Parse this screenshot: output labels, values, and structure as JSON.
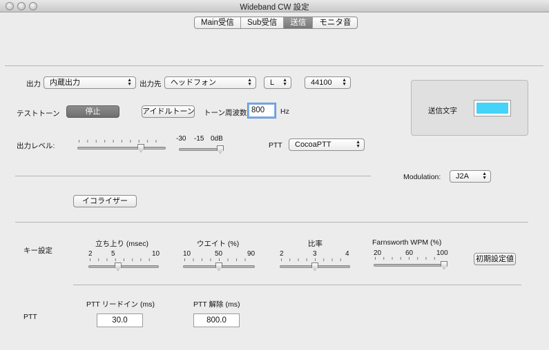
{
  "window": {
    "title": "Wideband CW 設定"
  },
  "tabs": [
    "Main受信",
    "Sub受信",
    "送信",
    "モニタ音"
  ],
  "active_tab_index": 2,
  "output": {
    "label": "出力",
    "device": "内蔵出力",
    "dest_label": "出力先",
    "dest": "ヘッドフォン",
    "channel": "L",
    "rate": "44100"
  },
  "test_tone": {
    "label": "テストトーン",
    "stop_button": "停止",
    "idle_button": "アイドルトーン",
    "freq_label": "トーン周波数",
    "freq_value": "800",
    "freq_unit": "Hz"
  },
  "send_text": {
    "label": "送信文字",
    "color": "#45d3fa"
  },
  "level": {
    "label": "出力レベル:",
    "slider1_value": 0.72,
    "slider2_ticks": [
      "-30",
      "-15",
      "0dB"
    ],
    "slider2_value": 1.0
  },
  "ptt_output": {
    "label": "PTT",
    "value": "CocoaPTT"
  },
  "modulation": {
    "label": "Modulation:",
    "value": "J2A"
  },
  "equalizer_button": "イコライザー",
  "key": {
    "section_label": "キー設定",
    "rise": {
      "label": "立ち上り (msec)",
      "ticks": [
        "2",
        "5",
        "10"
      ],
      "value": 0.42
    },
    "weight": {
      "label": "ウエイト (%)",
      "ticks": [
        "10",
        "50",
        "90"
      ],
      "value": 0.5
    },
    "ratio": {
      "label": "比率",
      "ticks": [
        "2",
        "3",
        "4"
      ],
      "value": 0.5
    },
    "farnsworth": {
      "label": "Farnsworth WPM (%)",
      "ticks": [
        "20",
        "60",
        "100"
      ],
      "value": 1.0
    },
    "reset_button": "初期設定値"
  },
  "ptt": {
    "section_label": "PTT",
    "leadin_label": "PTT リードイン (ms)",
    "leadin_value": "30.0",
    "release_label": "PTT 解除 (ms)",
    "release_value": "800.0"
  }
}
